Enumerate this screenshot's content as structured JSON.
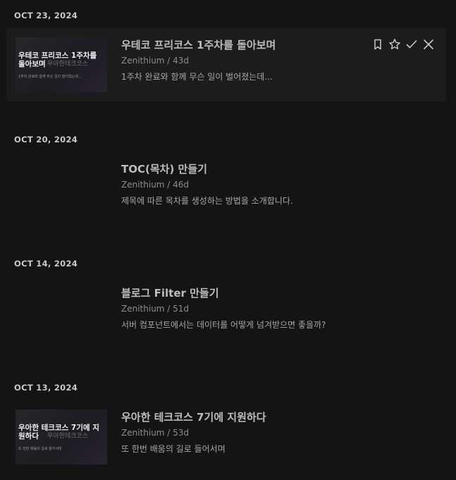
{
  "groups": [
    {
      "date": "OCT 23, 2024",
      "post": {
        "title": "우테코 프리코스 1주차를 돌아보며",
        "author": "Zenithium",
        "age": "43d",
        "excerpt": "1주차 완료와 함께 무슨 일이 벌어졌는데...",
        "thumbnail": {
          "title": "우테코 프리코스 1주차를 돌아보며",
          "overlay": "우아한테크코스",
          "subtitle": "1주차 완료와 함께 무슨 일이 벌어졌는데..."
        }
      }
    },
    {
      "date": "OCT 20, 2024",
      "post": {
        "title": "TOC(목차) 만들기",
        "author": "Zenithium",
        "age": "46d",
        "excerpt": "제목에 따른 목차를 생성하는 방법을 소개합니다."
      }
    },
    {
      "date": "OCT 14, 2024",
      "post": {
        "title": "블로그 Filter 만들기",
        "author": "Zenithium",
        "age": "51d",
        "excerpt": "서버 컴포넌트에서는 데이터를 어떻게 넘겨받으면 좋을까?"
      }
    },
    {
      "date": "OCT 13, 2024",
      "post": {
        "title": "우아한 테크코스 7기에 지원하다",
        "author": "Zenithium",
        "age": "53d",
        "excerpt": "또 한번 배움의 길로 들어서며",
        "thumbnail": {
          "title": "우아한 테크코스 7기에 지원하다",
          "overlay": "우아한테크코스",
          "subtitle": "또 한번 배움의 길로 들어서며"
        }
      }
    }
  ],
  "separator": " / ",
  "actions": [
    "bookmark-icon",
    "star-icon",
    "check-icon",
    "close-icon"
  ]
}
